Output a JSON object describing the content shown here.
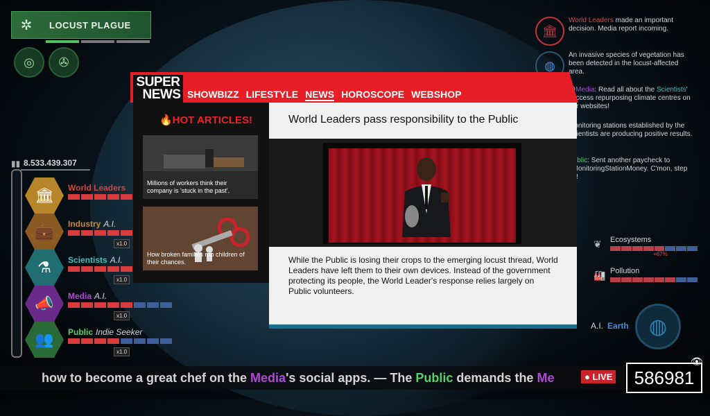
{
  "disaster": {
    "name": "LOCUST PLAGUE"
  },
  "population": {
    "value": "8.533.439.307"
  },
  "factions": [
    {
      "name": "World Leaders",
      "role": "",
      "color": "#d1453c",
      "hex": "#b8862a",
      "icon": "government-icon",
      "mult": ""
    },
    {
      "name": "Industry",
      "role": "A.I.",
      "color": "#c58a2c",
      "hex": "#8a5a22",
      "icon": "briefcase-icon",
      "mult": "x1.0"
    },
    {
      "name": "Scientists",
      "role": "A.I.",
      "color": "#35c7c2",
      "hex": "#206e72",
      "icon": "flask-icon",
      "mult": "x1.0"
    },
    {
      "name": "Media",
      "role": "A.I.",
      "color": "#b04ad6",
      "hex": "#6a2a8a",
      "icon": "megaphone-icon",
      "mult": "x1.0"
    },
    {
      "name": "Public",
      "role": "Indie Seeker",
      "color": "#58d06a",
      "hex": "#2a6a36",
      "icon": "people-icon",
      "mult": "x1.0"
    }
  ],
  "notifications": [
    {
      "hl": "World Leaders",
      "text": " made an important decision. Media report incoming.",
      "icon": "government-icon"
    },
    {
      "hl": "",
      "text": "An invasive species of vegetation has been detected in the locust-affected area.",
      "icon": "globe-icon"
    },
    {
      "pre": "@",
      "hl": "Media",
      "mid": ": Read all about the ",
      "hl2": "Scientists",
      "text": "' success repurposing climate centres on our websites!",
      "icon": "media-icon"
    },
    {
      "hl": "",
      "text": "Monitoring stations established by the Scientists are producing positive results.",
      "icon": "station-icon"
    },
    {
      "hl": "Public",
      "text": ": Sent another paycheck to #MonitoringStationMoney. C'mon, step up!",
      "icon": "public-icon"
    }
  ],
  "stats": [
    {
      "label": "Ecosystems",
      "pct": "+67%",
      "icon": "leaf-icon"
    },
    {
      "label": "Pollution",
      "pct": "",
      "icon": "factory-icon"
    }
  ],
  "ai_earth": {
    "ai": "A.I.",
    "name": "Earth"
  },
  "ticker": {
    "part1": "how to become a great chef on the ",
    "hl1": "Media",
    "part2": "'s social apps.  —  The ",
    "hl2": "Public",
    "part3": " demands the ",
    "hl3": "Me"
  },
  "live": "● LIVE",
  "score": "586981",
  "news": {
    "logo_top": "SUPER",
    "logo_bottom": "NEWS",
    "tabs": [
      "SHOWBIZZ",
      "LIFESTYLE",
      "NEWS",
      "HOROSCOPE",
      "WEBSHOP"
    ],
    "active_tab": 2,
    "hot_articles": "🔥HOT ARTICLES!",
    "cards": [
      {
        "caption": "Millions of workers think their company is 'stuck in the past'."
      },
      {
        "caption": "How broken families rob children of their chances."
      }
    ],
    "article": {
      "title": "World Leaders pass responsibility to the Public",
      "body": "While the Public is losing their crops to the emerging locust thread, World Leaders have left them to their own devices. Instead of the government protecting its people, the World Leader's response relies largely on Public volunteers."
    }
  }
}
